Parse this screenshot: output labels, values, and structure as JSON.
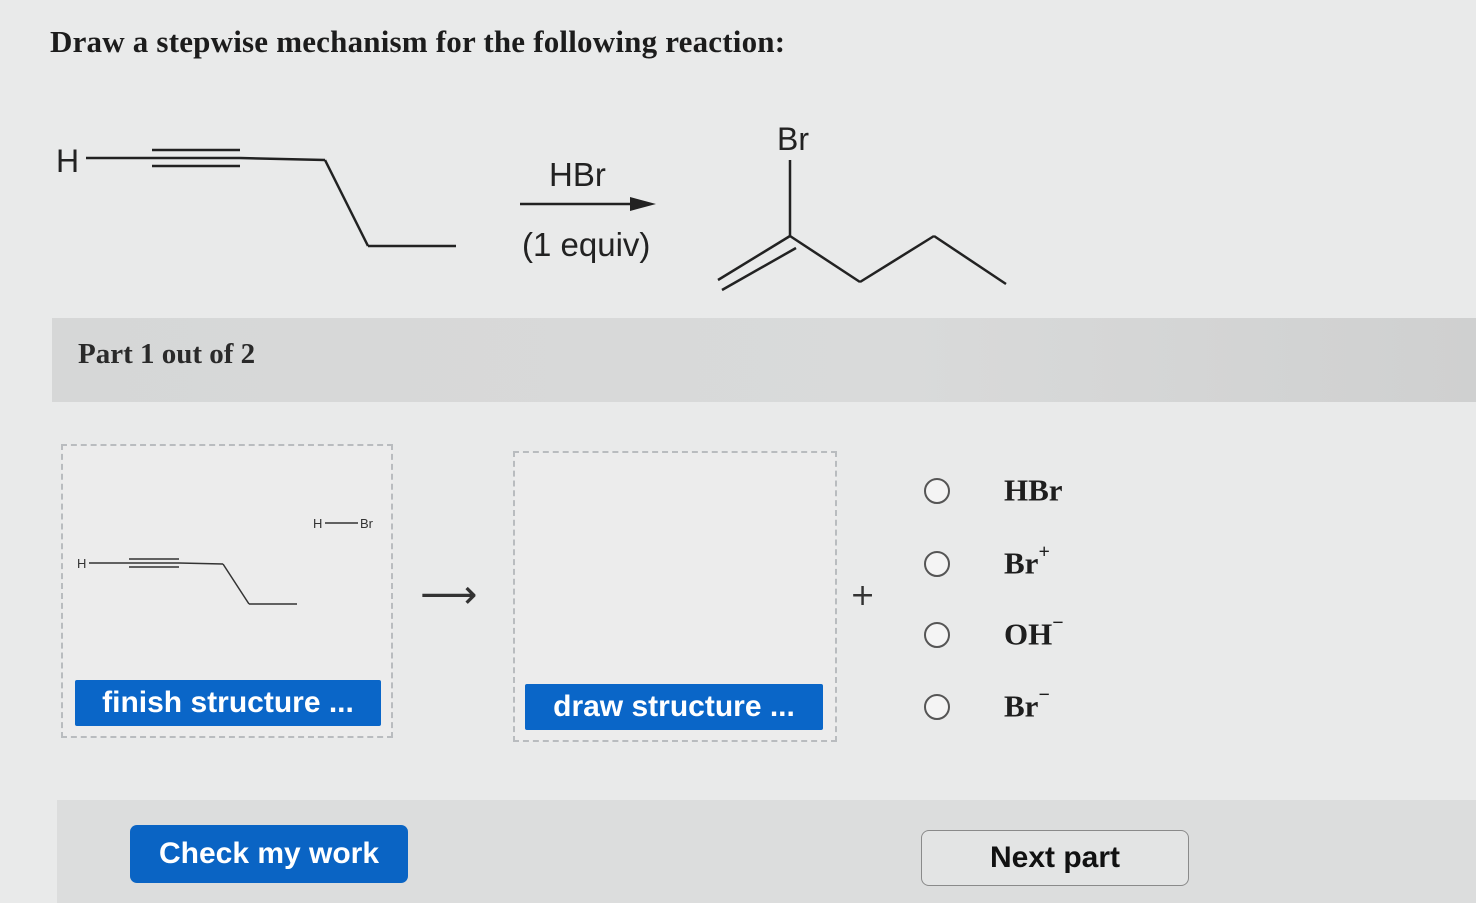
{
  "question": {
    "title": "Draw a stepwise mechanism for the following reaction:"
  },
  "reaction": {
    "reactant_atom_label": "H",
    "reagent": "HBr",
    "conditions": "(1 equiv)",
    "product_atom_label": "Br"
  },
  "part": {
    "label": "Part 1 out of 2"
  },
  "step": {
    "left_box": {
      "atom_h": "H",
      "hbr_h": "H",
      "hbr_br": "Br",
      "button_label": "finish structure ..."
    },
    "arrow": "⟶",
    "right_box": {
      "button_label": "draw structure ..."
    },
    "plus": "+",
    "options": [
      {
        "base": "HBr",
        "charge": ""
      },
      {
        "base": "Br",
        "charge": "+"
      },
      {
        "base": "OH",
        "charge": "−"
      },
      {
        "base": "Br",
        "charge": "−"
      }
    ]
  },
  "footer": {
    "check_label": "Check my work",
    "next_label": "Next part"
  },
  "colors": {
    "primary_button": "#0a66c8",
    "background": "#e9eaea",
    "part_bar": "#d6d7d7"
  }
}
